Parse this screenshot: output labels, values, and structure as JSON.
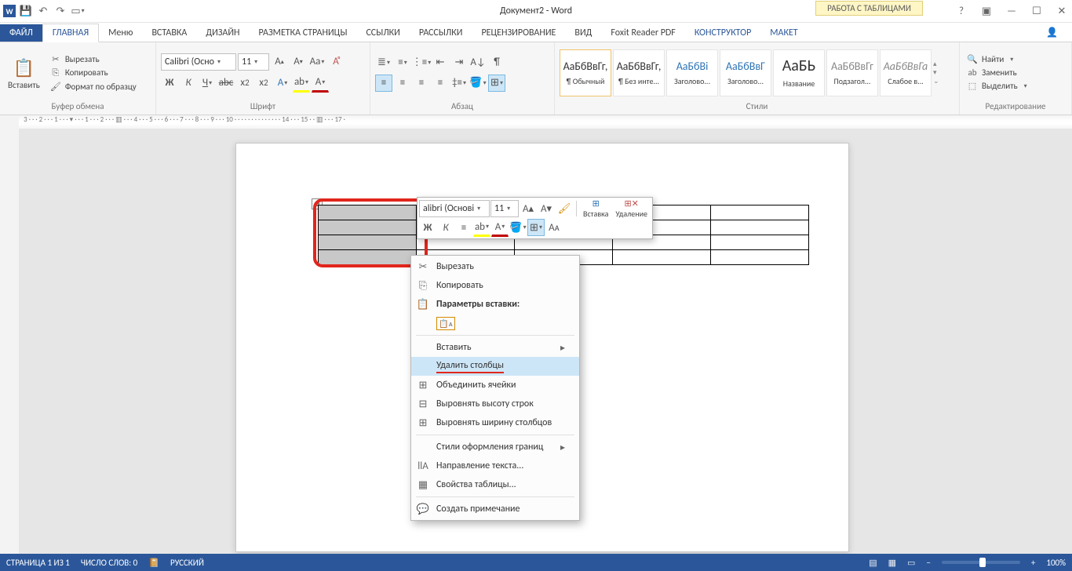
{
  "title": "Документ2 - Word",
  "table_tools_label": "РАБОТА С ТАБЛИЦАМИ",
  "login": "Вход",
  "tabs": {
    "file": "ФАЙЛ",
    "home": "ГЛАВНАЯ",
    "menu": "Меню",
    "insert": "ВСТАВКА",
    "design": "ДИЗАЙН",
    "layout": "РАЗМЕТКА СТРАНИЦЫ",
    "refs": "ССЫЛКИ",
    "mail": "РАССЫЛКИ",
    "review": "РЕЦЕНЗИРОВАНИЕ",
    "view": "ВИД",
    "foxit": "Foxit Reader PDF",
    "constructor": "КОНСТРУКТОР",
    "maket": "МАКЕТ"
  },
  "ribbon": {
    "clipboard": {
      "paste": "Вставить",
      "cut": "Вырезать",
      "copy": "Копировать",
      "format": "Формат по образцу",
      "label": "Буфер обмена"
    },
    "font": {
      "name": "Calibri (Осно",
      "size": "11",
      "label": "Шрифт"
    },
    "paragraph": {
      "label": "Абзац"
    },
    "styles": {
      "label": "Стили",
      "items": [
        {
          "preview": "АаБбВвГг,",
          "name": "¶ Обычный"
        },
        {
          "preview": "АаБбВвГг,",
          "name": "¶ Без инте..."
        },
        {
          "preview": "АаБбВі",
          "name": "Заголово..."
        },
        {
          "preview": "АаБбВвГ",
          "name": "Заголово..."
        },
        {
          "preview": "АаБЬ",
          "name": "Название"
        },
        {
          "preview": "АаБбВвГг",
          "name": "Подзагол..."
        },
        {
          "preview": "АаБбВвГа",
          "name": "Слабое в..."
        }
      ]
    },
    "editing": {
      "find": "Найти",
      "replace": "Заменить",
      "select": "Выделить",
      "label": "Редактирование"
    }
  },
  "mini": {
    "font": "alibri (Основі",
    "size": "11",
    "insert": "Вставка",
    "delete": "Удаление"
  },
  "context_menu": {
    "cut": "Вырезать",
    "copy": "Копировать",
    "paste_header": "Параметры вставки:",
    "insert": "Вставить",
    "delete_cols": "Удалить столбцы",
    "merge": "Объединить ячейки",
    "dist_rows": "Выровнять высоту строк",
    "dist_cols": "Выровнять ширину столбцов",
    "border_styles": "Стили оформления границ",
    "text_dir": "Направление текста...",
    "props": "Свойства таблицы...",
    "comment": "Создать примечание"
  },
  "status": {
    "page": "СТРАНИЦА 1 ИЗ 1",
    "words": "ЧИСЛО СЛОВ: 0",
    "lang": "РУССКИЙ",
    "zoom": "100%"
  }
}
